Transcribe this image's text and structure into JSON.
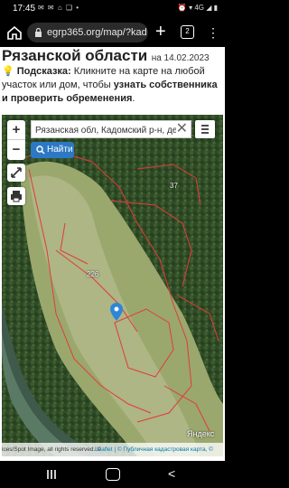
{
  "status_bar": {
    "time": "17:45",
    "left_icons": "✉ ✉ ⌂ ❏ •",
    "right_icons": "⏰ ▾ 4G ◢ ▮"
  },
  "browser": {
    "url": "egrp365.org/map/?kad",
    "tabs_count": "2"
  },
  "page": {
    "heading": "Рязанской области",
    "date_text": "на 14.02.2023",
    "hint_label": "Подсказка:",
    "hint_text": " Кликните на карте на любой участок или дом, чтобы ",
    "hint_bold": "узнать собственника и проверить обременения",
    "hint_end": "."
  },
  "map": {
    "search_value": "Рязанская обл, Кадомский р-н, деревн",
    "find_button": "Найти",
    "zoom_in": "+",
    "zoom_out": "−",
    "parcel_labels": [
      "37",
      "226"
    ],
    "attribution_left": "ices/Spot Image, all rights reserved. © ",
    "attribution_leaflet": "Leaflet",
    "attribution_right": " | © Публичная кадастровая карта, ©",
    "watermark": "Яндекс",
    "pin_color": "#2e86d9"
  }
}
